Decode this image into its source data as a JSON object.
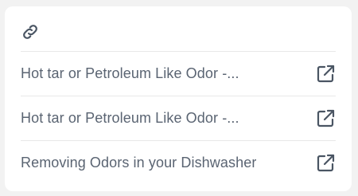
{
  "header": {
    "icon": "link-icon"
  },
  "links": [
    {
      "label": "Hot tar or Petroleum Like Odor -...",
      "icon": "external-link-icon"
    },
    {
      "label": "Hot tar or Petroleum Like Odor -...",
      "icon": "external-link-icon"
    },
    {
      "label": "Removing Odors in your Dishwasher",
      "icon": "external-link-icon"
    }
  ],
  "colors": {
    "text": "#5a6472",
    "icon": "#4a5563",
    "divider": "#e8e8e8",
    "card": "#ffffff",
    "background": "#f2f2f2"
  }
}
